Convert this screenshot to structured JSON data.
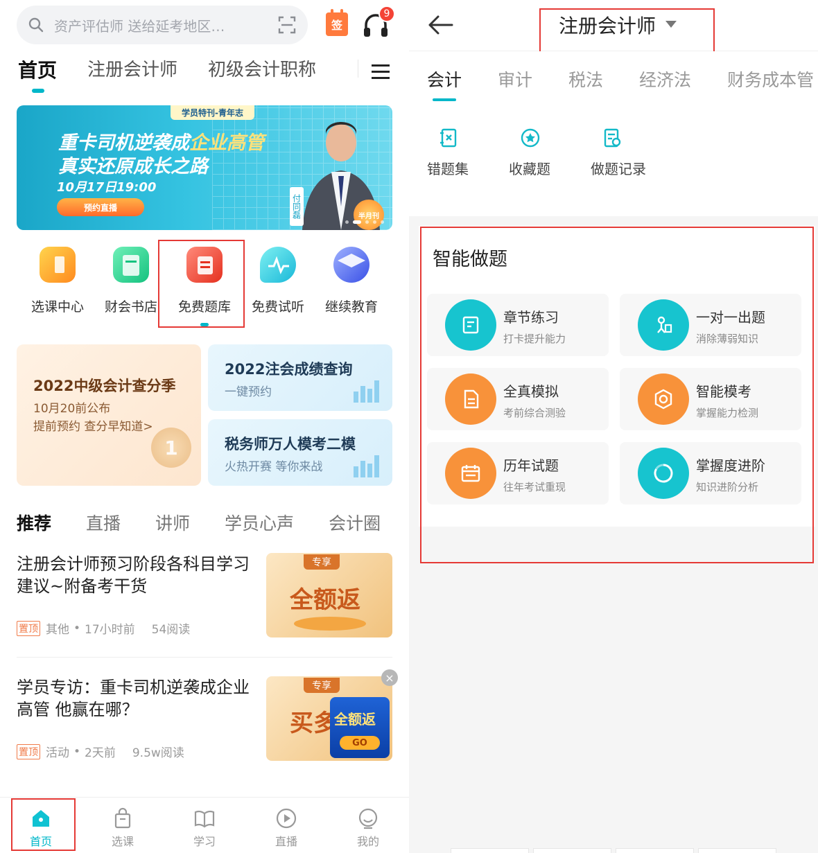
{
  "left": {
    "search": {
      "placeholder": "资产评估师 送给延考地区…",
      "icon": "search-icon",
      "scan_icon": "scan-icon"
    },
    "sign_label": "签",
    "notification_count": "9",
    "top_tabs": [
      {
        "label": "首页",
        "active": true
      },
      {
        "label": "注册会计师",
        "active": false
      },
      {
        "label": "初级会计职称",
        "active": false
      }
    ],
    "banner": {
      "tag": "学员特刊-青年志",
      "line1_a": "重卡司机逆袭成",
      "line1_b": "企业高管",
      "line2": "真实还原成长之路",
      "datetime": "10月17日19:00",
      "cta": "预约直播",
      "presenter": "付同磊",
      "badge": "半月刊"
    },
    "quick": [
      {
        "label": "选课中心",
        "color": "#ffa726"
      },
      {
        "label": "财会书店",
        "color": "#2bd39a"
      },
      {
        "label": "免费题库",
        "color": "#f04c3e"
      },
      {
        "label": "免费试听",
        "color": "#2ccfe0"
      },
      {
        "label": "继续教育",
        "color": "#4a62ee"
      }
    ],
    "promo_big": {
      "title": "2022中级会计查分季",
      "line1": "10月20前公布",
      "line2": "提前预约 查分早知道>",
      "medal": "1"
    },
    "promo_small": [
      {
        "title": "2022注会成绩查询",
        "subtitle": "一键预约"
      },
      {
        "title": "税务师万人模考二模",
        "subtitle": "火热开赛 等你来战"
      }
    ],
    "rec_tabs": [
      {
        "label": "推荐",
        "active": true
      },
      {
        "label": "直播",
        "active": false
      },
      {
        "label": "讲师",
        "active": false
      },
      {
        "label": "学员心声",
        "active": false
      },
      {
        "label": "会计圈",
        "active": false
      }
    ],
    "articles": [
      {
        "title": "注册会计师预习阶段各科目学习建议~附备考干货",
        "pin": "置顶",
        "category": "其他",
        "time": "17小时前",
        "reads": "54阅读",
        "thumb_tag": "专享",
        "thumb_text": "全额返"
      },
      {
        "title": "学员专访：重卡司机逆袭成企业高管 他赢在哪？",
        "pin": "置顶",
        "category": "活动",
        "time": "2天前",
        "reads": "9.5w阅读",
        "thumb_tag": "专享",
        "thumb_text": "买多",
        "thumb_overlay": "全额返",
        "thumb_go": "GO"
      }
    ],
    "bottom_nav": [
      {
        "label": "首页",
        "icon": "home-icon",
        "active": true
      },
      {
        "label": "选课",
        "icon": "bag-icon",
        "active": false
      },
      {
        "label": "学习",
        "icon": "book-icon",
        "active": false
      },
      {
        "label": "直播",
        "icon": "play-icon",
        "active": false
      },
      {
        "label": "我的",
        "icon": "profile-icon",
        "active": false
      }
    ]
  },
  "right": {
    "title": "注册会计师",
    "tabs": [
      {
        "label": "会计",
        "active": true
      },
      {
        "label": "审计",
        "active": false
      },
      {
        "label": "税法",
        "active": false
      },
      {
        "label": "经济法",
        "active": false
      },
      {
        "label": "财务成本管",
        "active": false
      }
    ],
    "tools": [
      {
        "label": "错题集",
        "icon": "wrong-book-icon"
      },
      {
        "label": "收藏题",
        "icon": "star-icon"
      },
      {
        "label": "做题记录",
        "icon": "record-icon"
      }
    ],
    "section_title": "智能做题",
    "practice": [
      {
        "title": "章节练习",
        "subtitle": "打卡提升能力",
        "color": "teal"
      },
      {
        "title": "一对一出题",
        "subtitle": "消除薄弱知识",
        "color": "teal"
      },
      {
        "title": "全真模拟",
        "subtitle": "考前综合测验",
        "color": "orange"
      },
      {
        "title": "智能模考",
        "subtitle": "掌握能力检测",
        "color": "orange"
      },
      {
        "title": "历年试题",
        "subtitle": "往年考试重现",
        "color": "orange"
      },
      {
        "title": "掌握度进阶",
        "subtitle": "知识进阶分析",
        "color": "teal"
      }
    ]
  }
}
